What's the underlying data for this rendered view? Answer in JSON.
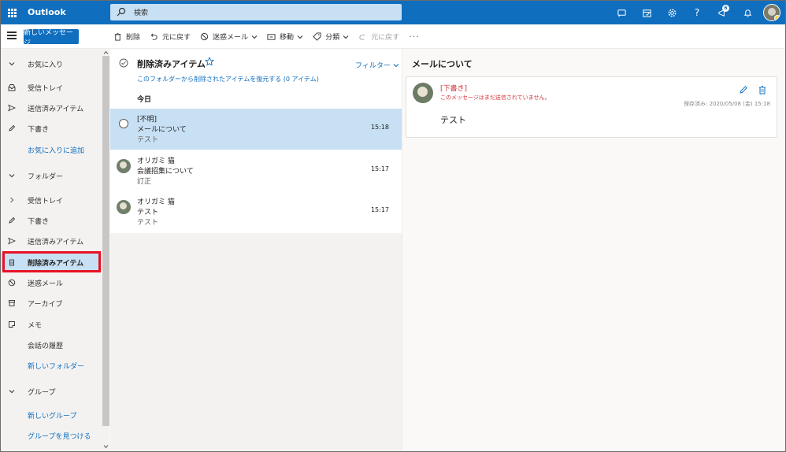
{
  "app": {
    "brand": "Outlook",
    "search_placeholder": "検索",
    "notification_count": "6"
  },
  "toolbar": {
    "new_message": "新しいメッセージ",
    "delete": "削除",
    "undo": "元に戻す",
    "junk": "迷惑メール",
    "move": "移動",
    "categorize": "分類",
    "undo_disabled": "元に戻す",
    "more": "···"
  },
  "nav": {
    "favorites": "お気に入り",
    "fav_inbox": "受信トレイ",
    "fav_sent": "送信済みアイテム",
    "fav_drafts": "下書き",
    "add_favorite": "お気に入りに追加",
    "folders": "フォルダー",
    "inbox": "受信トレイ",
    "drafts": "下書き",
    "sent": "送信済みアイテム",
    "deleted": "削除済みアイテム",
    "junk": "迷惑メール",
    "archive": "アーカイブ",
    "notes": "メモ",
    "history": "会話の履歴",
    "new_folder": "新しいフォルダー",
    "groups": "グループ",
    "new_group": "新しいグループ",
    "discover_groups": "グループを見つける"
  },
  "list": {
    "title": "削除済みアイテム",
    "filter": "フィルター",
    "restore_link": "このフォルダーから削除されたアイテムを復元する (0 アイテム)",
    "today": "今日",
    "messages": [
      {
        "sender": "[不明]",
        "subject": "メールについて",
        "preview": "テスト",
        "time": "15:18"
      },
      {
        "sender": "オリガミ 猫",
        "subject": "会議招集について",
        "preview": "訂正",
        "time": "15:17"
      },
      {
        "sender": "オリガミ 猫",
        "subject": "テスト",
        "preview": "テスト",
        "time": "15:17"
      }
    ]
  },
  "reading": {
    "title": "メールについて",
    "draft_label": "[下書き]",
    "not_sent": "このメッセージはまだ送信されていません。",
    "saved": "保存済み: 2020/05/08 (金) 15:18",
    "body": "テスト"
  },
  "colors": {
    "brand_blue": "#106ebe",
    "selected_bg": "#c7e0f4",
    "highlight_red": "#e81123",
    "draft_red": "#d13438"
  }
}
